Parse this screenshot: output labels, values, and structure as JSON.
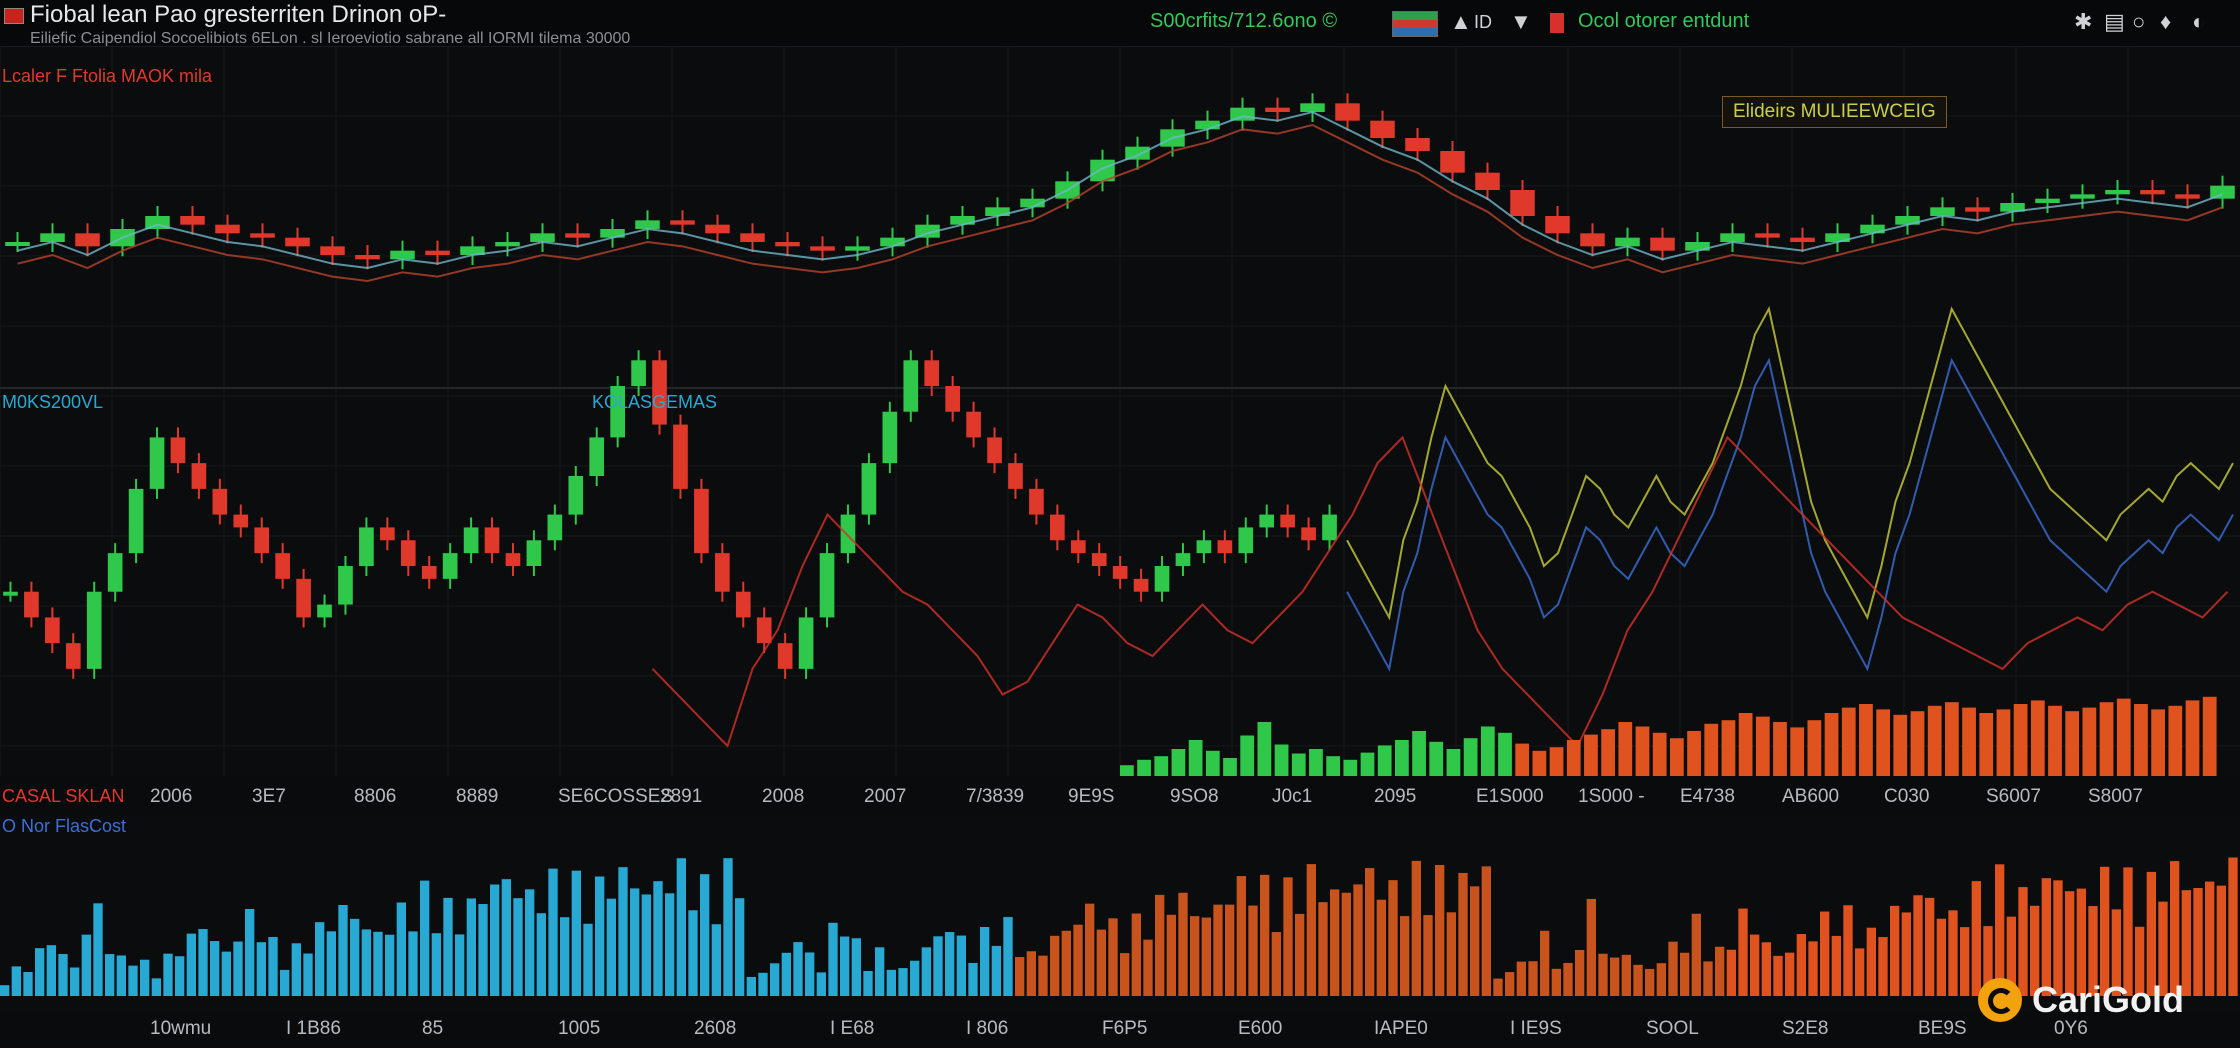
{
  "header": {
    "title": "Fiobal lean Pao gresterriten Drinon oP-",
    "subtitle": "Eiliefic Caipendiol Socoelibiots 6ELon . sl Ieroeviotio sabrane all IORMI tilema 30000",
    "ticker": "S00crfits/712.6ono ©",
    "status_text": "Ocol otorer entdunt",
    "icons": [
      "flag-icon",
      "up-arrow-icon",
      "id-icon",
      "bookmark-icon",
      "settings-icon",
      "layers-icon",
      "info-icon",
      "bell-icon",
      "user-icon"
    ]
  },
  "panes": {
    "price_label": "Lcaler F Ftolia MAOK mila",
    "price_badge": "Elideirs MULIEEWCEIG",
    "indicator_label_left": "M0KS200VL",
    "indicator_label_mid": "KOLASGEMAS",
    "volume_label_red": "CASAL SKLAN",
    "volume_label_blue": "O Nor FlasCost"
  },
  "axis": {
    "middle_ticks": [
      "2006",
      "3E7",
      "8806",
      "8889",
      "SE6COSSES",
      "2891",
      "2008",
      "2007",
      "7/3839",
      "9E9S",
      "9SO8",
      "J0c1",
      "2095",
      "E1S000",
      "1S000 -",
      "E4738",
      "AB600",
      "C030",
      "S6007",
      "S8007"
    ],
    "bottom_ticks": [
      "10wmu",
      "I 1B86",
      "85",
      "1005",
      "2608",
      "I E68",
      "I 806",
      "F6P5",
      "E600",
      "IAPE0",
      "I IE9S",
      "SOOL",
      "S2E8",
      "BE9S",
      "0Y6"
    ]
  },
  "colors": {
    "up": "#2fc84a",
    "down": "#e0392b",
    "volume_blue": "#27a9d3",
    "volume_orange": "#e0531f",
    "overlay_yellow": "#c9cf3a",
    "overlay_blue": "#3b6fd8",
    "accent": "#f2a20c"
  },
  "chart_data": {
    "type": "candlestick",
    "title": "",
    "price_up_counts_hint": "",
    "candles_top": [
      64,
      66,
      63,
      67,
      70,
      68,
      66,
      65,
      63,
      61,
      60,
      62,
      61,
      63,
      64,
      66,
      65,
      67,
      69,
      68,
      66,
      64,
      63,
      62,
      63,
      65,
      68,
      70,
      72,
      74,
      78,
      83,
      86,
      90,
      92,
      95,
      94,
      96,
      92,
      88,
      85,
      80,
      76,
      70,
      66,
      63,
      65,
      62,
      64,
      66,
      65,
      64,
      66,
      68,
      70,
      72,
      71,
      73,
      74,
      75,
      76,
      75,
      74,
      77
    ],
    "candles_bottom": [
      52,
      50,
      48,
      46,
      52,
      55,
      60,
      64,
      62,
      60,
      58,
      57,
      55,
      53,
      50,
      51,
      54,
      57,
      56,
      54,
      53,
      55,
      57,
      55,
      54,
      56,
      58,
      61,
      64,
      68,
      70,
      65,
      60,
      55,
      52,
      50,
      48,
      46,
      50,
      55,
      58,
      62,
      66,
      70,
      68,
      66,
      64,
      62,
      60,
      58,
      56,
      55,
      54,
      53,
      52,
      54,
      55,
      56,
      55,
      57,
      58,
      57,
      56,
      58
    ],
    "volume": [
      12,
      18,
      22,
      30,
      40,
      28,
      20,
      45,
      60,
      35,
      25,
      30,
      22,
      18,
      26,
      34,
      40,
      50,
      38,
      30,
      42,
      55,
      48,
      36,
      28,
      32,
      40,
      46,
      52,
      60,
      55,
      48,
      42,
      50,
      58,
      62,
      70,
      66,
      60,
      54,
      62,
      70,
      76,
      80,
      74,
      68,
      72,
      78,
      82,
      76,
      70,
      74,
      80,
      84,
      78,
      72,
      76,
      82,
      86,
      80,
      74,
      78,
      84,
      88
    ]
  }
}
